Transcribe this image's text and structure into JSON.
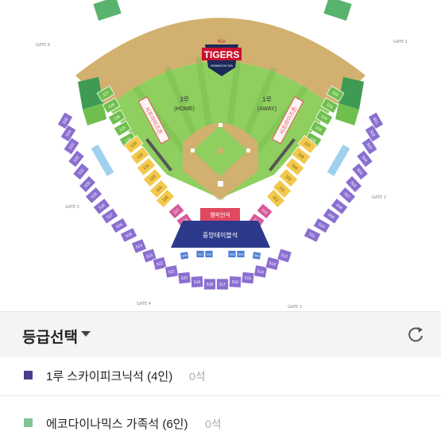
{
  "map": {
    "logo_small": "KIA",
    "logo_main": "TIGERS",
    "logo_sub": "GWANGJU KIA",
    "base_home_label": "3루",
    "base_home_sub": "(HOME)",
    "base_away_label": "1루",
    "base_away_sub": "(AWAY)",
    "central_table": "중앙테이블석",
    "premium": "챔피언석",
    "left_wing": "서프라이즈존",
    "right_wing": "서프라이즈존",
    "gates": {
      "gate1": "GATE 1",
      "gate2": "GATE 2",
      "gate3": "GATE 3",
      "gate4": "GATE 4",
      "gate5": "GATE 5",
      "gate6": "GATE 6"
    },
    "left_upper": [
      "127",
      "128",
      "126",
      "125",
      "124"
    ],
    "left_mid": [
      "123",
      "122",
      "121",
      "120",
      "119",
      "118"
    ],
    "left_pink": [
      "117",
      "116"
    ],
    "right_upper": [
      "102",
      "103",
      "104",
      "105",
      "106"
    ],
    "right_mid": [
      "107",
      "108",
      "109",
      "110",
      "111",
      "112"
    ],
    "right_pink": [
      "113",
      "114"
    ],
    "purple_bottom": [
      "524",
      "523",
      "522",
      "521",
      "520",
      "519",
      "518",
      "517",
      "516",
      "515",
      "514",
      "513",
      "512"
    ],
    "purple_left": [
      "535",
      "534",
      "533",
      "532",
      "531",
      "530",
      "529",
      "528",
      "527",
      "526",
      "525"
    ],
    "purple_right": [
      "501",
      "502",
      "503",
      "504",
      "505",
      "506",
      "507",
      "508",
      "509",
      "510",
      "511"
    ],
    "blue_small": [
      "311",
      "310",
      "309",
      "302",
      "303",
      "304"
    ]
  },
  "grade_panel": {
    "title": "등급선택",
    "items": [
      {
        "label": "1루 스카이피크닉석 (4인)",
        "count": "0석",
        "color": "#4a3d8f"
      },
      {
        "label": "에코다이나믹스 가족석 (6인)",
        "count": "0석",
        "color": "#7fc592"
      }
    ]
  },
  "colors": {
    "field_grass": "#8fcf5f",
    "field_stripe": "#82c654",
    "dirt": "#d2b06f",
    "yellow_seat": "#f2c94c",
    "pink_seat": "#d65a9a",
    "green_seat": "#6fbf4f",
    "purple_seat": "#8a6fd0",
    "navy_seat": "#2d3a8c",
    "blue_seat": "#4a7dd4"
  }
}
